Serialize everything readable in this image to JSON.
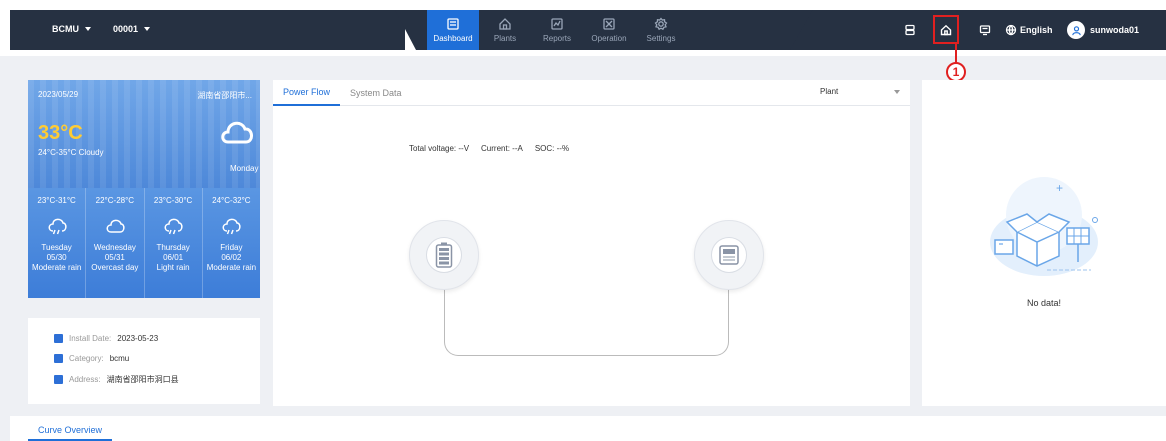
{
  "header": {
    "device_select": "BCMU",
    "id_select": "00001",
    "nav": [
      {
        "label": "Dashboard",
        "icon": "dashboard-icon",
        "active": true
      },
      {
        "label": "Plants",
        "icon": "plants-icon",
        "active": false
      },
      {
        "label": "Reports",
        "icon": "reports-icon",
        "active": false
      },
      {
        "label": "Operation",
        "icon": "operation-icon",
        "active": false
      },
      {
        "label": "Settings",
        "icon": "settings-icon",
        "active": false
      }
    ],
    "language": "English",
    "username": "sunwoda01",
    "annotation_marker": "1"
  },
  "weather": {
    "date": "2023/05/29",
    "location": "湖南省邵阳市...",
    "temperature": "33°C",
    "condition": "24°C-35°C Cloudy",
    "weekday": "Monday",
    "forecast": [
      {
        "range": "23°C-31°C",
        "day": "Tuesday",
        "date": "05/30",
        "desc": "Moderate rain",
        "icon": "rain-icon"
      },
      {
        "range": "22°C-28°C",
        "day": "Wednesday",
        "date": "05/31",
        "desc": "Overcast day",
        "icon": "cloud-icon"
      },
      {
        "range": "23°C-30°C",
        "day": "Thursday",
        "date": "06/01",
        "desc": "Light rain",
        "icon": "rain-icon"
      },
      {
        "range": "24°C-32°C",
        "day": "Friday",
        "date": "06/02",
        "desc": "Moderate rain",
        "icon": "rain-icon"
      }
    ]
  },
  "info": {
    "install_label": "Install Date: ",
    "install_value": "2023-05-23",
    "category_label": "Category: ",
    "category_value": "bcmu",
    "address_label": "Address: ",
    "address_value": "湖南省邵阳市洞口县"
  },
  "power_flow": {
    "tabs": [
      "Power Flow",
      "System Data"
    ],
    "plant_select": "Plant",
    "voltage": "Total voltage:  --V",
    "current": "Current:  --A",
    "soc": "SOC:  --%"
  },
  "right_panel": {
    "empty_text": "No data!"
  },
  "bottom": {
    "tab": "Curve Overview"
  },
  "colors": {
    "accent": "#1f6fd8",
    "header_bg": "#263142",
    "highlight": "#e02020"
  }
}
